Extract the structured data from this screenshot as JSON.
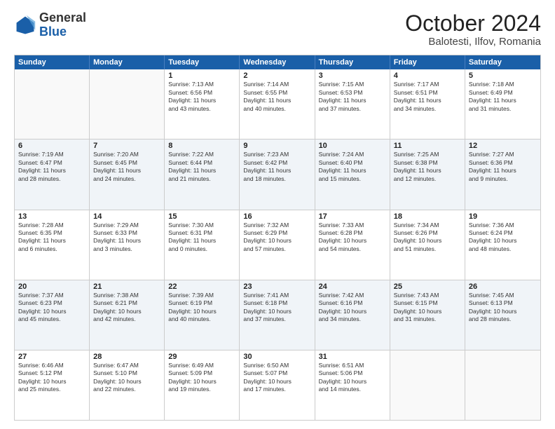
{
  "logo": {
    "general": "General",
    "blue": "Blue"
  },
  "title": "October 2024",
  "subtitle": "Balotesti, Ilfov, Romania",
  "header_days": [
    "Sunday",
    "Monday",
    "Tuesday",
    "Wednesday",
    "Thursday",
    "Friday",
    "Saturday"
  ],
  "rows": [
    {
      "alt": false,
      "cells": [
        {
          "day": "",
          "lines": []
        },
        {
          "day": "",
          "lines": []
        },
        {
          "day": "1",
          "lines": [
            "Sunrise: 7:13 AM",
            "Sunset: 6:56 PM",
            "Daylight: 11 hours",
            "and 43 minutes."
          ]
        },
        {
          "day": "2",
          "lines": [
            "Sunrise: 7:14 AM",
            "Sunset: 6:55 PM",
            "Daylight: 11 hours",
            "and 40 minutes."
          ]
        },
        {
          "day": "3",
          "lines": [
            "Sunrise: 7:15 AM",
            "Sunset: 6:53 PM",
            "Daylight: 11 hours",
            "and 37 minutes."
          ]
        },
        {
          "day": "4",
          "lines": [
            "Sunrise: 7:17 AM",
            "Sunset: 6:51 PM",
            "Daylight: 11 hours",
            "and 34 minutes."
          ]
        },
        {
          "day": "5",
          "lines": [
            "Sunrise: 7:18 AM",
            "Sunset: 6:49 PM",
            "Daylight: 11 hours",
            "and 31 minutes."
          ]
        }
      ]
    },
    {
      "alt": true,
      "cells": [
        {
          "day": "6",
          "lines": [
            "Sunrise: 7:19 AM",
            "Sunset: 6:47 PM",
            "Daylight: 11 hours",
            "and 28 minutes."
          ]
        },
        {
          "day": "7",
          "lines": [
            "Sunrise: 7:20 AM",
            "Sunset: 6:45 PM",
            "Daylight: 11 hours",
            "and 24 minutes."
          ]
        },
        {
          "day": "8",
          "lines": [
            "Sunrise: 7:22 AM",
            "Sunset: 6:44 PM",
            "Daylight: 11 hours",
            "and 21 minutes."
          ]
        },
        {
          "day": "9",
          "lines": [
            "Sunrise: 7:23 AM",
            "Sunset: 6:42 PM",
            "Daylight: 11 hours",
            "and 18 minutes."
          ]
        },
        {
          "day": "10",
          "lines": [
            "Sunrise: 7:24 AM",
            "Sunset: 6:40 PM",
            "Daylight: 11 hours",
            "and 15 minutes."
          ]
        },
        {
          "day": "11",
          "lines": [
            "Sunrise: 7:25 AM",
            "Sunset: 6:38 PM",
            "Daylight: 11 hours",
            "and 12 minutes."
          ]
        },
        {
          "day": "12",
          "lines": [
            "Sunrise: 7:27 AM",
            "Sunset: 6:36 PM",
            "Daylight: 11 hours",
            "and 9 minutes."
          ]
        }
      ]
    },
    {
      "alt": false,
      "cells": [
        {
          "day": "13",
          "lines": [
            "Sunrise: 7:28 AM",
            "Sunset: 6:35 PM",
            "Daylight: 11 hours",
            "and 6 minutes."
          ]
        },
        {
          "day": "14",
          "lines": [
            "Sunrise: 7:29 AM",
            "Sunset: 6:33 PM",
            "Daylight: 11 hours",
            "and 3 minutes."
          ]
        },
        {
          "day": "15",
          "lines": [
            "Sunrise: 7:30 AM",
            "Sunset: 6:31 PM",
            "Daylight: 11 hours",
            "and 0 minutes."
          ]
        },
        {
          "day": "16",
          "lines": [
            "Sunrise: 7:32 AM",
            "Sunset: 6:29 PM",
            "Daylight: 10 hours",
            "and 57 minutes."
          ]
        },
        {
          "day": "17",
          "lines": [
            "Sunrise: 7:33 AM",
            "Sunset: 6:28 PM",
            "Daylight: 10 hours",
            "and 54 minutes."
          ]
        },
        {
          "day": "18",
          "lines": [
            "Sunrise: 7:34 AM",
            "Sunset: 6:26 PM",
            "Daylight: 10 hours",
            "and 51 minutes."
          ]
        },
        {
          "day": "19",
          "lines": [
            "Sunrise: 7:36 AM",
            "Sunset: 6:24 PM",
            "Daylight: 10 hours",
            "and 48 minutes."
          ]
        }
      ]
    },
    {
      "alt": true,
      "cells": [
        {
          "day": "20",
          "lines": [
            "Sunrise: 7:37 AM",
            "Sunset: 6:23 PM",
            "Daylight: 10 hours",
            "and 45 minutes."
          ]
        },
        {
          "day": "21",
          "lines": [
            "Sunrise: 7:38 AM",
            "Sunset: 6:21 PM",
            "Daylight: 10 hours",
            "and 42 minutes."
          ]
        },
        {
          "day": "22",
          "lines": [
            "Sunrise: 7:39 AM",
            "Sunset: 6:19 PM",
            "Daylight: 10 hours",
            "and 40 minutes."
          ]
        },
        {
          "day": "23",
          "lines": [
            "Sunrise: 7:41 AM",
            "Sunset: 6:18 PM",
            "Daylight: 10 hours",
            "and 37 minutes."
          ]
        },
        {
          "day": "24",
          "lines": [
            "Sunrise: 7:42 AM",
            "Sunset: 6:16 PM",
            "Daylight: 10 hours",
            "and 34 minutes."
          ]
        },
        {
          "day": "25",
          "lines": [
            "Sunrise: 7:43 AM",
            "Sunset: 6:15 PM",
            "Daylight: 10 hours",
            "and 31 minutes."
          ]
        },
        {
          "day": "26",
          "lines": [
            "Sunrise: 7:45 AM",
            "Sunset: 6:13 PM",
            "Daylight: 10 hours",
            "and 28 minutes."
          ]
        }
      ]
    },
    {
      "alt": false,
      "cells": [
        {
          "day": "27",
          "lines": [
            "Sunrise: 6:46 AM",
            "Sunset: 5:12 PM",
            "Daylight: 10 hours",
            "and 25 minutes."
          ]
        },
        {
          "day": "28",
          "lines": [
            "Sunrise: 6:47 AM",
            "Sunset: 5:10 PM",
            "Daylight: 10 hours",
            "and 22 minutes."
          ]
        },
        {
          "day": "29",
          "lines": [
            "Sunrise: 6:49 AM",
            "Sunset: 5:09 PM",
            "Daylight: 10 hours",
            "and 19 minutes."
          ]
        },
        {
          "day": "30",
          "lines": [
            "Sunrise: 6:50 AM",
            "Sunset: 5:07 PM",
            "Daylight: 10 hours",
            "and 17 minutes."
          ]
        },
        {
          "day": "31",
          "lines": [
            "Sunrise: 6:51 AM",
            "Sunset: 5:06 PM",
            "Daylight: 10 hours",
            "and 14 minutes."
          ]
        },
        {
          "day": "",
          "lines": []
        },
        {
          "day": "",
          "lines": []
        }
      ]
    }
  ]
}
